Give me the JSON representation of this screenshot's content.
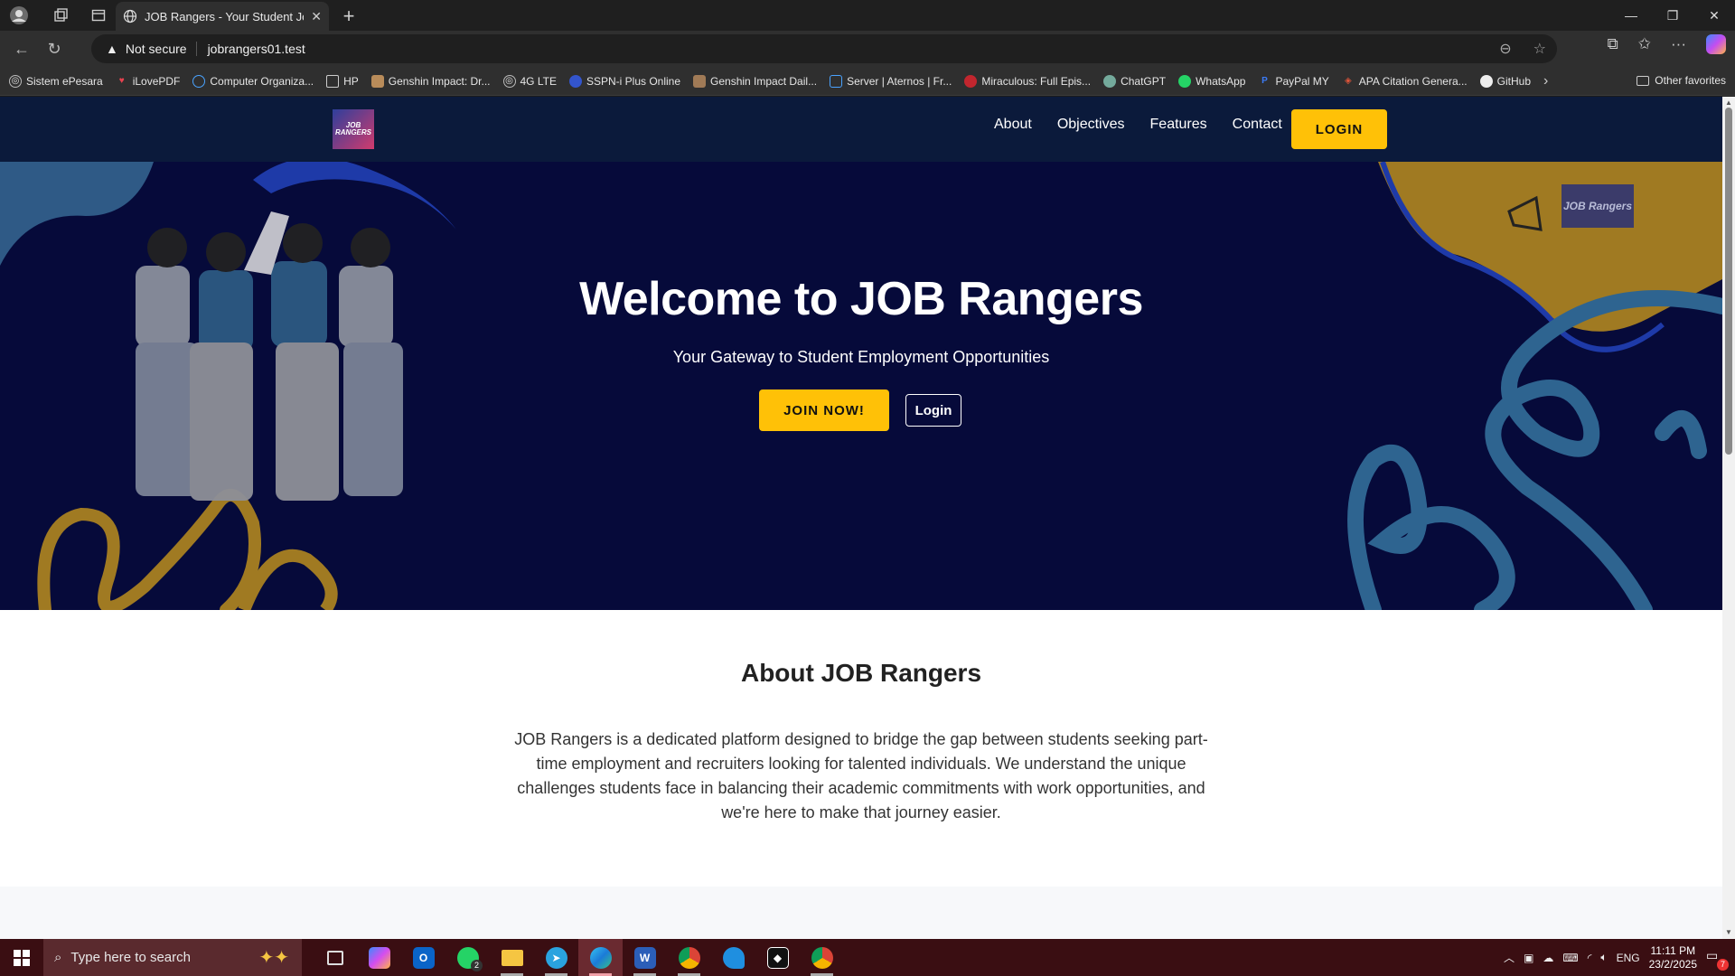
{
  "browser": {
    "tab_title": "JOB Rangers - Your Student Job P",
    "address_security": "Not secure",
    "url": "jobrangers01.test",
    "bookmarks": [
      {
        "label": "Sistem ePesara",
        "icon": "globe-icon"
      },
      {
        "label": "iLovePDF",
        "icon": "heart-icon"
      },
      {
        "label": "Computer Organiza...",
        "icon": "q-icon"
      },
      {
        "label": "HP",
        "icon": "folder-icon"
      },
      {
        "label": "Genshin Impact: Dr...",
        "icon": "image-icon"
      },
      {
        "label": "4G LTE",
        "icon": "globe-icon"
      },
      {
        "label": "SSPN-i Plus Online",
        "icon": "sspn-icon"
      },
      {
        "label": "Genshin Impact Dail...",
        "icon": "image-icon"
      },
      {
        "label": "Server | Aternos | Fr...",
        "icon": "server-icon"
      },
      {
        "label": "Miraculous: Full Epis...",
        "icon": "ladybug-icon"
      },
      {
        "label": "ChatGPT",
        "icon": "chatgpt-icon"
      },
      {
        "label": "WhatsApp",
        "icon": "whatsapp-icon"
      },
      {
        "label": "PayPal MY",
        "icon": "paypal-icon"
      },
      {
        "label": "APA Citation Genera...",
        "icon": "citation-icon"
      },
      {
        "label": "GitHub",
        "icon": "github-icon"
      }
    ],
    "other_favorites": "Other favorites"
  },
  "site": {
    "nav": {
      "logo_text": "JOB Rangers",
      "links": [
        "About",
        "Objectives",
        "Features",
        "Contact"
      ],
      "login": "LOGIN"
    },
    "hero": {
      "title": "Welcome to JOB Rangers",
      "subtitle": "Your Gateway to Student Employment Opportunities",
      "join_button": "JOIN NOW!",
      "login_button": "Login",
      "badge_text": "JOB Rangers"
    },
    "about": {
      "heading": "About JOB Rangers",
      "body": "JOB Rangers is a dedicated platform designed to bridge the gap between students seeking part-time employment and recruiters looking for talented individuals. We understand the unique challenges students face in balancing their academic commitments with work opportunities, and we're here to make that journey easier."
    }
  },
  "taskbar": {
    "search_placeholder": "Type here to search",
    "apps": [
      {
        "name": "task-view-icon"
      },
      {
        "name": "copilot-icon"
      },
      {
        "name": "outlook-icon"
      },
      {
        "name": "whatsapp-icon",
        "badge": "2"
      },
      {
        "name": "file-explorer-icon"
      },
      {
        "name": "telegram-icon"
      },
      {
        "name": "edge-icon"
      },
      {
        "name": "word-icon"
      },
      {
        "name": "chrome-icon"
      },
      {
        "name": "app-blue-icon"
      },
      {
        "name": "capcut-icon"
      },
      {
        "name": "chrome-profile-icon"
      }
    ],
    "language": "ENG",
    "time": "11:11 PM",
    "date": "23/2/2025",
    "notification_count": "7"
  },
  "colors": {
    "nav_bg": "#0b1a3b",
    "hero_bg": "#060a3a",
    "accent_yellow": "#ffc107",
    "taskbar_bg": "#3a0e12"
  }
}
